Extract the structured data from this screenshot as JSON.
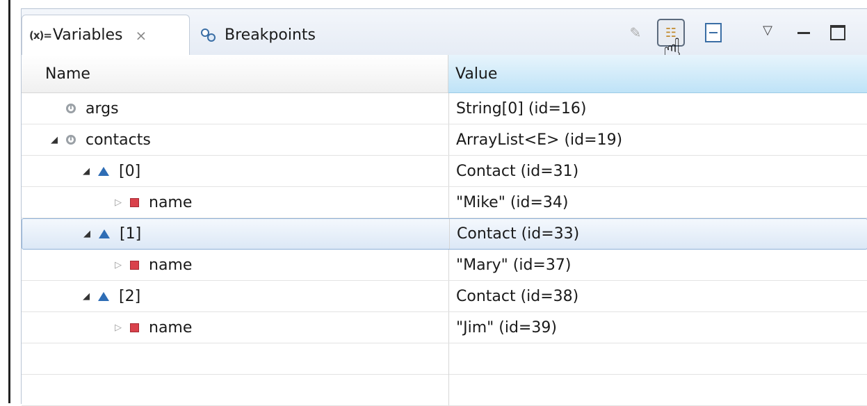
{
  "tabs": {
    "variables": {
      "prefix": "(x)=",
      "label": "Variables",
      "close": "⨯"
    },
    "breakpoints": {
      "label": "Breakpoints"
    }
  },
  "columns": {
    "name": "Name",
    "value": "Value"
  },
  "rows": [
    {
      "name": "args",
      "value": "String[0]  (id=16)",
      "icon": "local-variable-icon",
      "twisty": "none",
      "indent": 0
    },
    {
      "name": "contacts",
      "value": "ArrayList<E>  (id=19)",
      "icon": "local-variable-icon",
      "twisty": "expanded",
      "indent": 0
    },
    {
      "name": "[0]",
      "value": "Contact  (id=31)",
      "icon": "field-icon",
      "twisty": "expanded",
      "indent": 1
    },
    {
      "name": "name",
      "value": "\"Mike\" (id=34)",
      "icon": "private-field-icon",
      "twisty": "collapsed",
      "indent": 2
    },
    {
      "name": "[1]",
      "value": "Contact  (id=33)",
      "icon": "field-icon",
      "twisty": "expanded",
      "indent": 1,
      "selected": true
    },
    {
      "name": "name",
      "value": "\"Mary\" (id=37)",
      "icon": "private-field-icon",
      "twisty": "collapsed",
      "indent": 2
    },
    {
      "name": "[2]",
      "value": "Contact  (id=38)",
      "icon": "field-icon",
      "twisty": "expanded",
      "indent": 1
    },
    {
      "name": "name",
      "value": "\"Jim\" (id=39)",
      "icon": "private-field-icon",
      "twisty": "collapsed",
      "indent": 2
    }
  ],
  "toolbar": {
    "icons": [
      "show-type-names-icon",
      "layout-icon",
      "collapse-all-icon",
      "view-menu-icon",
      "minimize-icon",
      "maximize-icon"
    ]
  },
  "colors": {
    "selection": "#dce8f6",
    "value_header": "#bfe3f7",
    "private_field": "#d9414b",
    "field": "#2e6db5"
  }
}
